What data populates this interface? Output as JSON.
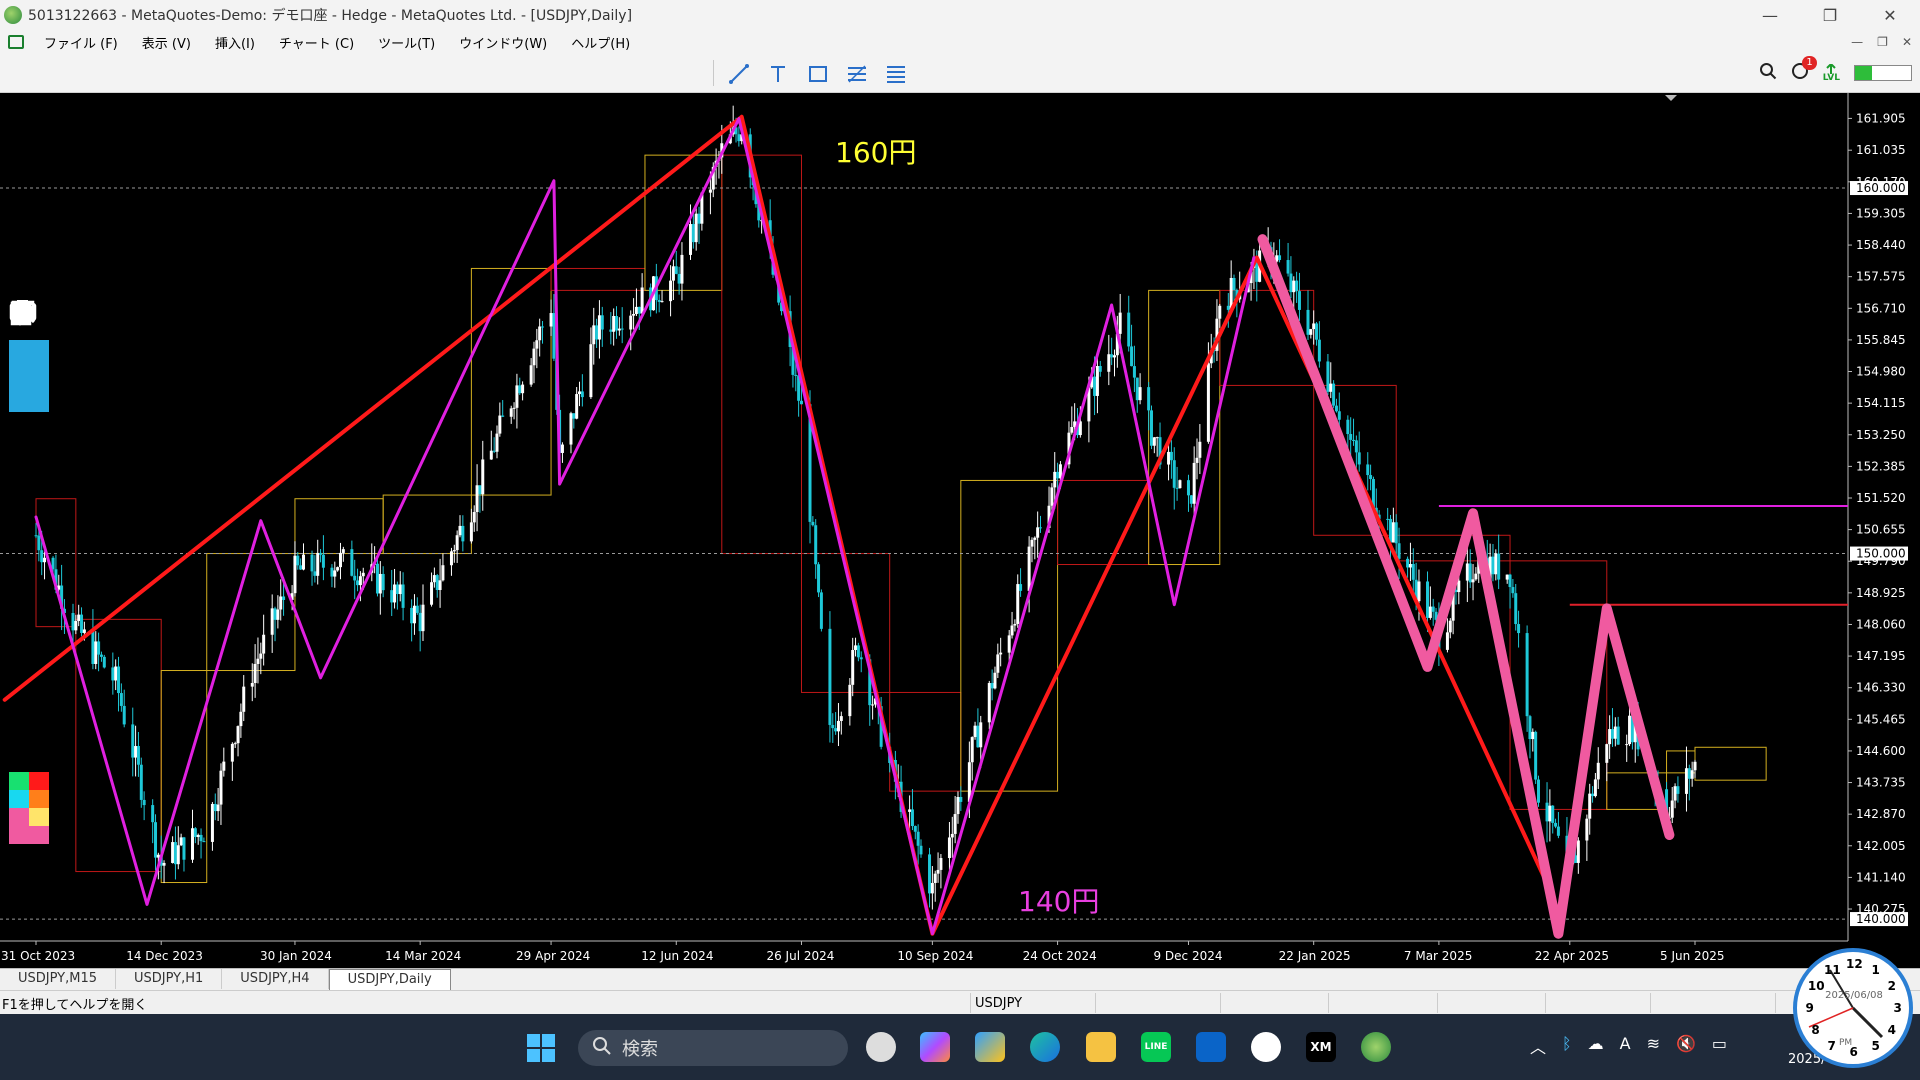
{
  "window": {
    "title": "5013122663 - MetaQuotes-Demo: デモ口座 - Hedge - MetaQuotes Ltd. - [USDJPY,Daily]",
    "minimize": "—",
    "maximize": "❐",
    "close": "✕"
  },
  "menu": {
    "items": [
      "ファイル (F)",
      "表示 (V)",
      "挿入(I)",
      "チャート (C)",
      "ツール(T)",
      "ウインドウ(W)",
      "ヘルプ(H)"
    ]
  },
  "toolbar": {
    "tools": [
      "trendline-icon",
      "text-icon",
      "rectangle-icon",
      "fibonacci-icon",
      "channel-icon"
    ],
    "notifications_count": "1",
    "lvl_label": "LVL",
    "signal_fill": 0.3
  },
  "chart": {
    "symbol": "USDJPY",
    "timeframe": "Daily",
    "annotations": [
      {
        "text": "160円",
        "color": "#ffff33"
      },
      {
        "text": "140円",
        "color": "#e83fe0"
      }
    ],
    "price_highlights": [
      "160.000",
      "150.000",
      "140.000"
    ]
  },
  "chart_data": {
    "type": "candlestick",
    "price_axis": [
      "161.905",
      "161.035",
      "160.170",
      "159.305",
      "158.440",
      "157.575",
      "156.710",
      "155.845",
      "154.980",
      "154.115",
      "153.250",
      "152.385",
      "151.520",
      "150.655",
      "149.790",
      "148.925",
      "148.060",
      "147.195",
      "146.330",
      "145.465",
      "144.600",
      "143.735",
      "142.870",
      "142.005",
      "141.140",
      "140.275"
    ],
    "date_axis": [
      "31 Oct 2023",
      "14 Dec 2023",
      "30 Jan 2024",
      "14 Mar 2024",
      "29 Apr 2024",
      "12 Jun 2024",
      "26 Jul 2024",
      "10 Sep 2024",
      "24 Oct 2024",
      "9 Dec 2024",
      "22 Jan 2025",
      "7 Mar 2025",
      "22 Apr 2025",
      "5 Jun 2025"
    ],
    "ylim": [
      139.4,
      162.6
    ],
    "horizontal_levels": [
      {
        "price": 160.0,
        "style": "dotted",
        "color": "#9a9a9a"
      },
      {
        "price": 150.0,
        "style": "dotted",
        "color": "#9a9a9a"
      },
      {
        "price": 140.0,
        "style": "dotted",
        "color": "#9a9a9a"
      },
      {
        "price": 151.3,
        "style": "solid",
        "color": "#e020e0",
        "from_date": "7 Mar 2025"
      },
      {
        "price": 148.6,
        "style": "solid",
        "color": "#e0202a",
        "from_date": "22 Apr 2025"
      }
    ],
    "close_series": [
      [
        "31 Oct 2023",
        150.5
      ],
      [
        "14 Nov 2023",
        148.0
      ],
      [
        "28 Nov 2023",
        146.5
      ],
      [
        "14 Dec 2023",
        141.5
      ],
      [
        "30 Dec 2023",
        142.5
      ],
      [
        "15 Jan 2024",
        146.8
      ],
      [
        "30 Jan 2024",
        149.5
      ],
      [
        "15 Feb 2024",
        149.8
      ],
      [
        "1 Mar 2024",
        149.2
      ],
      [
        "14 Mar 2024",
        148.2
      ],
      [
        "1 Apr 2024",
        151.3
      ],
      [
        "15 Apr 2024",
        154.2
      ],
      [
        "29 Apr 2024",
        156.8
      ],
      [
        "2 May 2024",
        152.5
      ],
      [
        "15 May 2024",
        156.1
      ],
      [
        "1 Jun 2024",
        157.0
      ],
      [
        "12 Jun 2024",
        157.5
      ],
      [
        "28 Jun 2024",
        161.0
      ],
      [
        "5 Jul 2024",
        161.7
      ],
      [
        "15 Jul 2024",
        158.0
      ],
      [
        "26 Jul 2024",
        153.9
      ],
      [
        "5 Aug 2024",
        145.0
      ],
      [
        "15 Aug 2024",
        147.5
      ],
      [
        "26 Aug 2024",
        144.2
      ],
      [
        "10 Sep 2024",
        140.8
      ],
      [
        "20 Sep 2024",
        143.5
      ],
      [
        "1 Oct 2024",
        146.5
      ],
      [
        "15 Oct 2024",
        150.0
      ],
      [
        "24 Oct 2024",
        152.5
      ],
      [
        "5 Nov 2024",
        154.5
      ],
      [
        "15 Nov 2024",
        156.2
      ],
      [
        "25 Nov 2024",
        153.5
      ],
      [
        "9 Dec 2024",
        151.2
      ],
      [
        "20 Dec 2024",
        156.9
      ],
      [
        "8 Jan 2025",
        158.2
      ],
      [
        "22 Jan 2025",
        156.0
      ],
      [
        "5 Feb 2025",
        152.8
      ],
      [
        "20 Feb 2025",
        150.3
      ],
      [
        "7 Mar 2025",
        147.8
      ],
      [
        "20 Mar 2025",
        149.8
      ],
      [
        "1 Apr 2025",
        149.5
      ],
      [
        "11 Apr 2025",
        143.5
      ],
      [
        "22 Apr 2025",
        141.2
      ],
      [
        "5 May 2025",
        145.0
      ],
      [
        "15 May 2025",
        145.3
      ],
      [
        "26 May 2025",
        143.0
      ],
      [
        "5 Jun 2025",
        144.2
      ]
    ],
    "zigzags": [
      {
        "color": "#ff1a1a",
        "width": 4,
        "points": [
          [
            "20 Oct 2023",
            146.0
          ],
          [
            "5 Jul 2024",
            161.95
          ],
          [
            "10 Sep 2024",
            139.6
          ],
          [
            "2 Jan 2025",
            158.1
          ],
          [
            "15 Apr 2025",
            140.8
          ]
        ]
      },
      {
        "color": "#ff1a1a",
        "width": 3,
        "points": [
          [
            "5 Jul 2024",
            161.95
          ],
          [
            "10 Sep 2024",
            139.6
          ]
        ]
      },
      {
        "color": "#e020e0",
        "width": 3,
        "points": [
          [
            "31 Oct 2023",
            151.0
          ],
          [
            "9 Dec 2023",
            140.4
          ],
          [
            "18 Jan 2024",
            150.9
          ],
          [
            "8 Feb 2024",
            146.6
          ],
          [
            "30 Apr 2024",
            160.2
          ],
          [
            "2 May 2024",
            151.9
          ],
          [
            "4 Jul 2024",
            161.9
          ],
          [
            "10 Sep 2024",
            139.6
          ],
          [
            "12 Nov 2024",
            156.8
          ],
          [
            "4 Dec 2024",
            148.6
          ],
          [
            "1 Jan 2025",
            158.1
          ]
        ]
      },
      {
        "color": "#f05aa0",
        "width": 10,
        "points": [
          [
            "4 Jan 2025",
            158.6
          ],
          [
            "3 Mar 2025",
            146.9
          ],
          [
            "19 Mar 2025",
            151.1
          ],
          [
            "18 Apr 2025",
            139.6
          ],
          [
            "5 May 2025",
            148.5
          ],
          [
            "27 May 2025",
            142.3
          ]
        ]
      }
    ],
    "monthly_boxes": [
      {
        "from": "31 Oct 2023",
        "to": "14 Nov 2023",
        "open": 151.5,
        "close": 148.0,
        "color": "#c01818"
      },
      {
        "from": "14 Nov 2023",
        "to": "14 Dec 2023",
        "open": 148.2,
        "close": 141.3,
        "color": "#c01818"
      },
      {
        "from": "14 Dec 2023",
        "to": "30 Dec 2023",
        "open": 141.0,
        "close": 146.8,
        "color": "#d4b020"
      },
      {
        "from": "30 Dec 2023",
        "to": "30 Jan 2024",
        "open": 146.8,
        "close": 150.0,
        "color": "#d4b020"
      },
      {
        "from": "30 Jan 2024",
        "to": "1 Mar 2024",
        "open": 150.0,
        "close": 151.5,
        "color": "#d4b020"
      },
      {
        "from": "1 Mar 2024",
        "to": "1 Apr 2024",
        "open": 150.0,
        "close": 151.6,
        "color": "#d4b020"
      },
      {
        "from": "1 Apr 2024",
        "to": "29 Apr 2024",
        "open": 151.6,
        "close": 157.8,
        "color": "#d4b020"
      },
      {
        "from": "29 Apr 2024",
        "to": "1 Jun 2024",
        "open": 157.8,
        "close": 157.2,
        "color": "#c01818"
      },
      {
        "from": "1 Jun 2024",
        "to": "28 Jun 2024",
        "open": 157.2,
        "close": 160.9,
        "color": "#d4b020"
      },
      {
        "from": "28 Jun 2024",
        "to": "26 Jul 2024",
        "open": 160.9,
        "close": 150.0,
        "color": "#c01818"
      },
      {
        "from": "26 Jul 2024",
        "to": "26 Aug 2024",
        "open": 150.0,
        "close": 146.2,
        "color": "#c01818"
      },
      {
        "from": "26 Aug 2024",
        "to": "20 Sep 2024",
        "open": 146.2,
        "close": 143.5,
        "color": "#c01818"
      },
      {
        "from": "20 Sep 2024",
        "to": "24 Oct 2024",
        "open": 143.5,
        "close": 152.0,
        "color": "#d4b020"
      },
      {
        "from": "24 Oct 2024",
        "to": "25 Nov 2024",
        "open": 152.0,
        "close": 149.7,
        "color": "#c01818"
      },
      {
        "from": "25 Nov 2024",
        "to": "20 Dec 2024",
        "open": 149.7,
        "close": 157.2,
        "color": "#d4b020"
      },
      {
        "from": "20 Dec 2024",
        "to": "22 Jan 2025",
        "open": 157.2,
        "close": 154.6,
        "color": "#c01818"
      },
      {
        "from": "22 Jan 2025",
        "to": "20 Feb 2025",
        "open": 154.6,
        "close": 150.5,
        "color": "#c01818"
      },
      {
        "from": "20 Feb 2025",
        "to": "1 Apr 2025",
        "open": 150.5,
        "close": 149.8,
        "color": "#c01818"
      },
      {
        "from": "1 Apr 2025",
        "to": "5 May 2025",
        "open": 149.8,
        "close": 143.0,
        "color": "#c01818"
      },
      {
        "from": "5 May 2025",
        "to": "26 May 2025",
        "open": 143.0,
        "close": 144.0,
        "color": "#d4b020"
      },
      {
        "from": "26 May 2025",
        "to": "5 Jun 2025",
        "open": 144.0,
        "close": 144.6,
        "color": "#d4b020"
      },
      {
        "from": "5 Jun 2025",
        "to": "30 Jun 2025",
        "open": 143.8,
        "close": 144.7,
        "color": "#d4b020"
      }
    ]
  },
  "palette": {
    "tools": [
      "pen-icon",
      "eye-icon",
      "cursor-icon",
      "hide-icon",
      "eraser-icon",
      "line-icon",
      "ruler-icon",
      "dot-icon",
      "undo-icon",
      "trash-icon",
      "stamp-icon",
      "camera-icon",
      "clipboard-icon"
    ],
    "colors": [
      "#18e070",
      "#ff1a1a",
      "#18d8f0",
      "#ff7f1a",
      "#f05aa0",
      "#ffe46a",
      "#f05aa0",
      "#f05aa0"
    ]
  },
  "tabs": [
    "USDJPY,M15",
    "USDJPY,H1",
    "USDJPY,H4",
    "USDJPY,Daily"
  ],
  "status": {
    "help": "F1を押してヘルプを開く",
    "symbol": "USDJPY"
  },
  "taskbar": {
    "search_text": "検索",
    "apps": [
      "clock-app",
      "copilot-app",
      "store-app",
      "edge-app",
      "explorer-app",
      "line-app",
      "outlook-app",
      "pen-app",
      "xm-app",
      "mt5-app"
    ],
    "date_text": "2025/",
    "line_label": "LINE",
    "xm_label": "XM"
  },
  "clock": {
    "date": "2025/06/08",
    "ampm": "PM",
    "numbers": [
      "12",
      "1",
      "2",
      "3",
      "4",
      "5",
      "6",
      "7",
      "8",
      "9",
      "10",
      "11"
    ]
  }
}
